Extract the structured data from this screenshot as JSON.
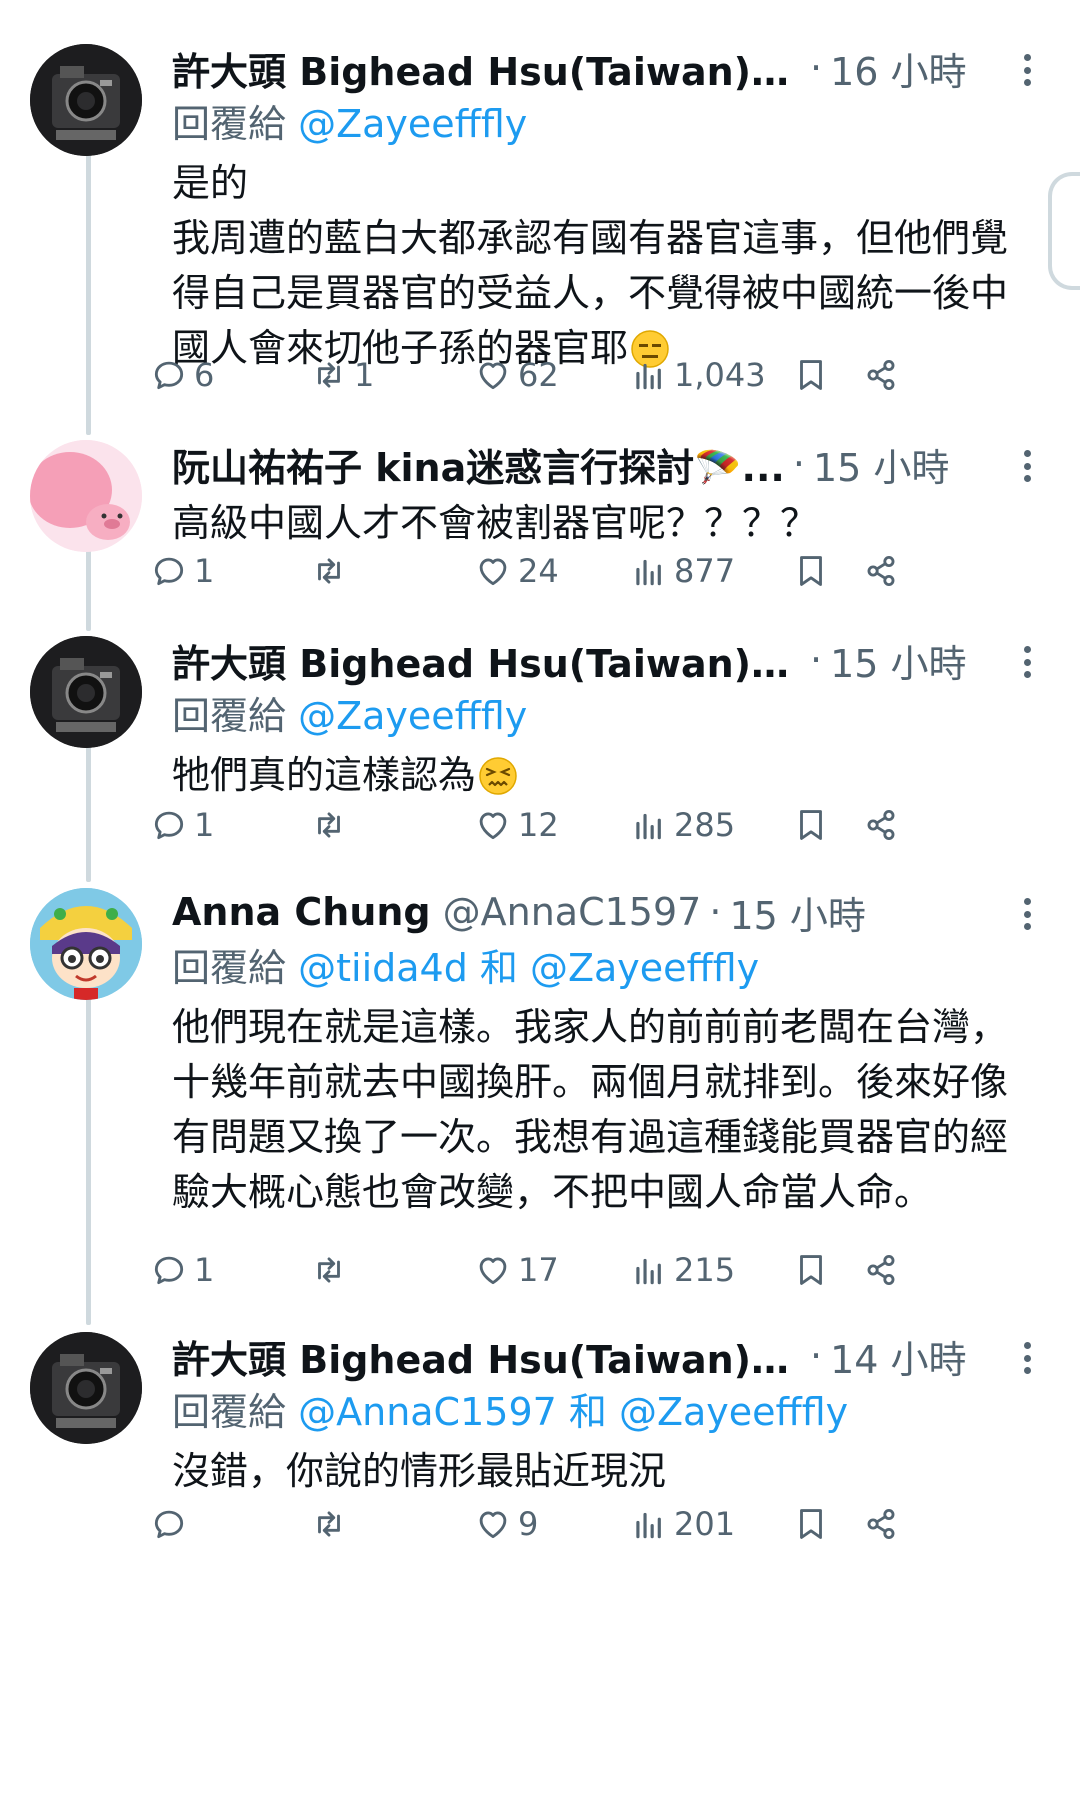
{
  "tweets": [
    {
      "author_name": "許大頭 Bighead Hsu(Taiwan)等...",
      "time": "16 小時",
      "reply_prefix": "回覆給",
      "mentions": "@Zayeefffly",
      "text": "是的\n我周遭的藍白大都承認有國有器官這事，但他們覺得自己是買器官的受益人，不覺得被中國統一後中國人會來切他子孫的器官耶",
      "emoji": "expressionless-face-emoji",
      "replies": "6",
      "reposts": "1",
      "likes": "62",
      "views": "1,043",
      "avatar": "camera-avatar"
    },
    {
      "author_name": "阮山祐祐子 kina迷惑言行探討🪂...",
      "time": "15 小時",
      "text": "高級中國人才不會被割器官呢？？？？",
      "replies": "1",
      "reposts": "",
      "likes": "24",
      "views": "877",
      "avatar": "pink-pig-avatar"
    },
    {
      "author_name": "許大頭 Bighead Hsu(Taiwan)等...",
      "time": "15 小時",
      "reply_prefix": "回覆給",
      "mentions": "@Zayeefffly",
      "text": "牠們真的這樣認為",
      "emoji": "confounded-face-emoji",
      "replies": "1",
      "reposts": "",
      "likes": "12",
      "views": "285",
      "avatar": "camera-avatar"
    },
    {
      "author_name": "Anna Chung",
      "handle": "@AnnaC1597",
      "time": "15 小時",
      "reply_prefix": "回覆給",
      "mentions": "@tiida4d 和 @Zayeefffly",
      "text": "他們現在就是這樣。我家人的前前前老闆在台灣，十幾年前就去中國換肝。兩個月就排到。後來好像有問題又換了一次。我想有過這種錢能買器官的經驗大概心態也會改變，不把中國人命當人命。",
      "replies": "1",
      "reposts": "",
      "likes": "17",
      "views": "215",
      "avatar": "cartoon-girl-avatar"
    },
    {
      "author_name": "許大頭 Bighead Hsu(Taiwan)等...",
      "time": "14 小時",
      "reply_prefix": "回覆給",
      "mentions": "@AnnaC1597 和 @Zayeefffly",
      "text": "沒錯，你說的情形最貼近現況",
      "replies": "",
      "reposts": "",
      "likes": "9",
      "views": "201",
      "avatar": "camera-avatar"
    }
  ],
  "colors": {
    "text": "#0f1419",
    "muted": "#536471",
    "link": "#1d9bf0",
    "thread_line": "#cfd9de"
  }
}
